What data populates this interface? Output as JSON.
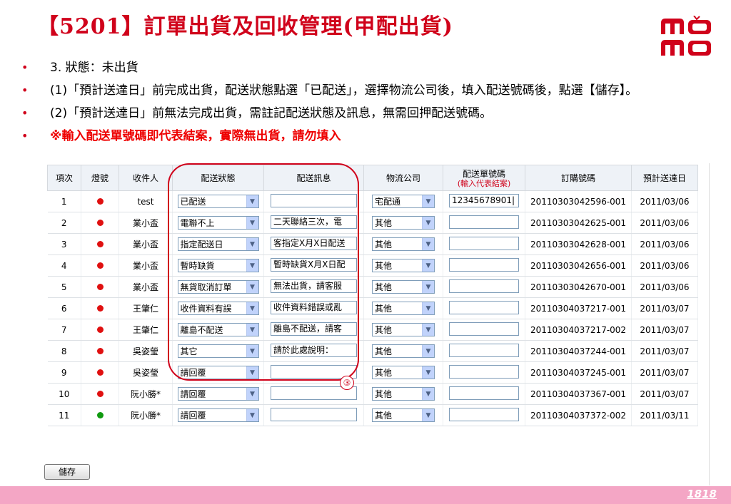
{
  "slide": {
    "title": "【5201】訂單出貨及回收管理(甲配出貨)",
    "page_number": "1818"
  },
  "logo": {
    "line1": "mo",
    "line2": "mo"
  },
  "bullets": [
    {
      "text": "3. 狀態：未出貨",
      "red": false
    },
    {
      "text": "(1)「預計送達日」前完成出貨，配送狀態點選「已配送」，選擇物流公司後，填入配送號碼後，點選【儲存】。",
      "red": false
    },
    {
      "text": "(2)「預計送達日」前無法完成出貨，需註記配送狀態及訊息，無需回押配送號碼。",
      "red": false
    },
    {
      "text": "※輸入配送單號碼即代表結案，實際無出貨，請勿填入",
      "red": true
    }
  ],
  "table": {
    "headers": {
      "no": "項次",
      "light": "燈號",
      "recipient": "收件人",
      "status": "配送狀態",
      "message": "配送訊息",
      "logistics": "物流公司",
      "tracking": "配送單號碼",
      "tracking_note": "(輸入代表結案)",
      "order": "訂購號碼",
      "eta": "預計送達日"
    },
    "rows": [
      {
        "no": "1",
        "light": "red",
        "recipient": "test",
        "status": "已配送",
        "message": "",
        "logistics": "宅配通",
        "tracking": "12345678901|",
        "order": "20110303042596-001",
        "eta": "2011/03/06"
      },
      {
        "no": "2",
        "light": "red",
        "recipient": "業小盃",
        "status": "電聯不上",
        "message": "二天聯絡三次，電",
        "logistics": "其他",
        "tracking": "",
        "order": "20110303042625-001",
        "eta": "2011/03/06"
      },
      {
        "no": "3",
        "light": "red",
        "recipient": "業小盃",
        "status": "指定配送日",
        "message": "客指定X月X日配送",
        "logistics": "其他",
        "tracking": "",
        "order": "20110303042628-001",
        "eta": "2011/03/06"
      },
      {
        "no": "4",
        "light": "red",
        "recipient": "業小盃",
        "status": "暫時缺貨",
        "message": "暫時缺貨X月X日配",
        "logistics": "其他",
        "tracking": "",
        "order": "20110303042656-001",
        "eta": "2011/03/06"
      },
      {
        "no": "5",
        "light": "red",
        "recipient": "業小盃",
        "status": "無貨取消訂單",
        "message": "無法出貨，請客服",
        "logistics": "其他",
        "tracking": "",
        "order": "20110303042670-001",
        "eta": "2011/03/06"
      },
      {
        "no": "6",
        "light": "red",
        "recipient": "王肇仁",
        "status": "收件資料有誤",
        "message": "收件資料錯誤或亂",
        "logistics": "其他",
        "tracking": "",
        "order": "20110304037217-001",
        "eta": "2011/03/07"
      },
      {
        "no": "7",
        "light": "red",
        "recipient": "王肇仁",
        "status": "離島不配送",
        "message": "離島不配送，請客",
        "logistics": "其他",
        "tracking": "",
        "order": "20110304037217-002",
        "eta": "2011/03/07"
      },
      {
        "no": "8",
        "light": "red",
        "recipient": "吳姿瑩",
        "status": "其它",
        "message": "請於此處說明：",
        "logistics": "其他",
        "tracking": "",
        "order": "20110304037244-001",
        "eta": "2011/03/07"
      },
      {
        "no": "9",
        "light": "red",
        "recipient": "吳姿瑩",
        "status": "請回覆",
        "message": "",
        "logistics": "其他",
        "tracking": "",
        "order": "20110304037245-001",
        "eta": "2011/03/07"
      },
      {
        "no": "10",
        "light": "red",
        "recipient": "阮小勝*",
        "status": "請回覆",
        "message": "",
        "logistics": "其他",
        "tracking": "",
        "order": "20110304037367-001",
        "eta": "2011/03/07"
      },
      {
        "no": "11",
        "light": "green",
        "recipient": "阮小勝*",
        "status": "請回覆",
        "message": "",
        "logistics": "其他",
        "tracking": "",
        "order": "20110304037372-002",
        "eta": "2011/03/11"
      }
    ]
  },
  "annotation_marker": "③",
  "save_label": "儲存",
  "colors": {
    "accent": "#d0021b",
    "footer": "#f4a6c5",
    "light_red": "#e01010",
    "light_green": "#109a10"
  }
}
